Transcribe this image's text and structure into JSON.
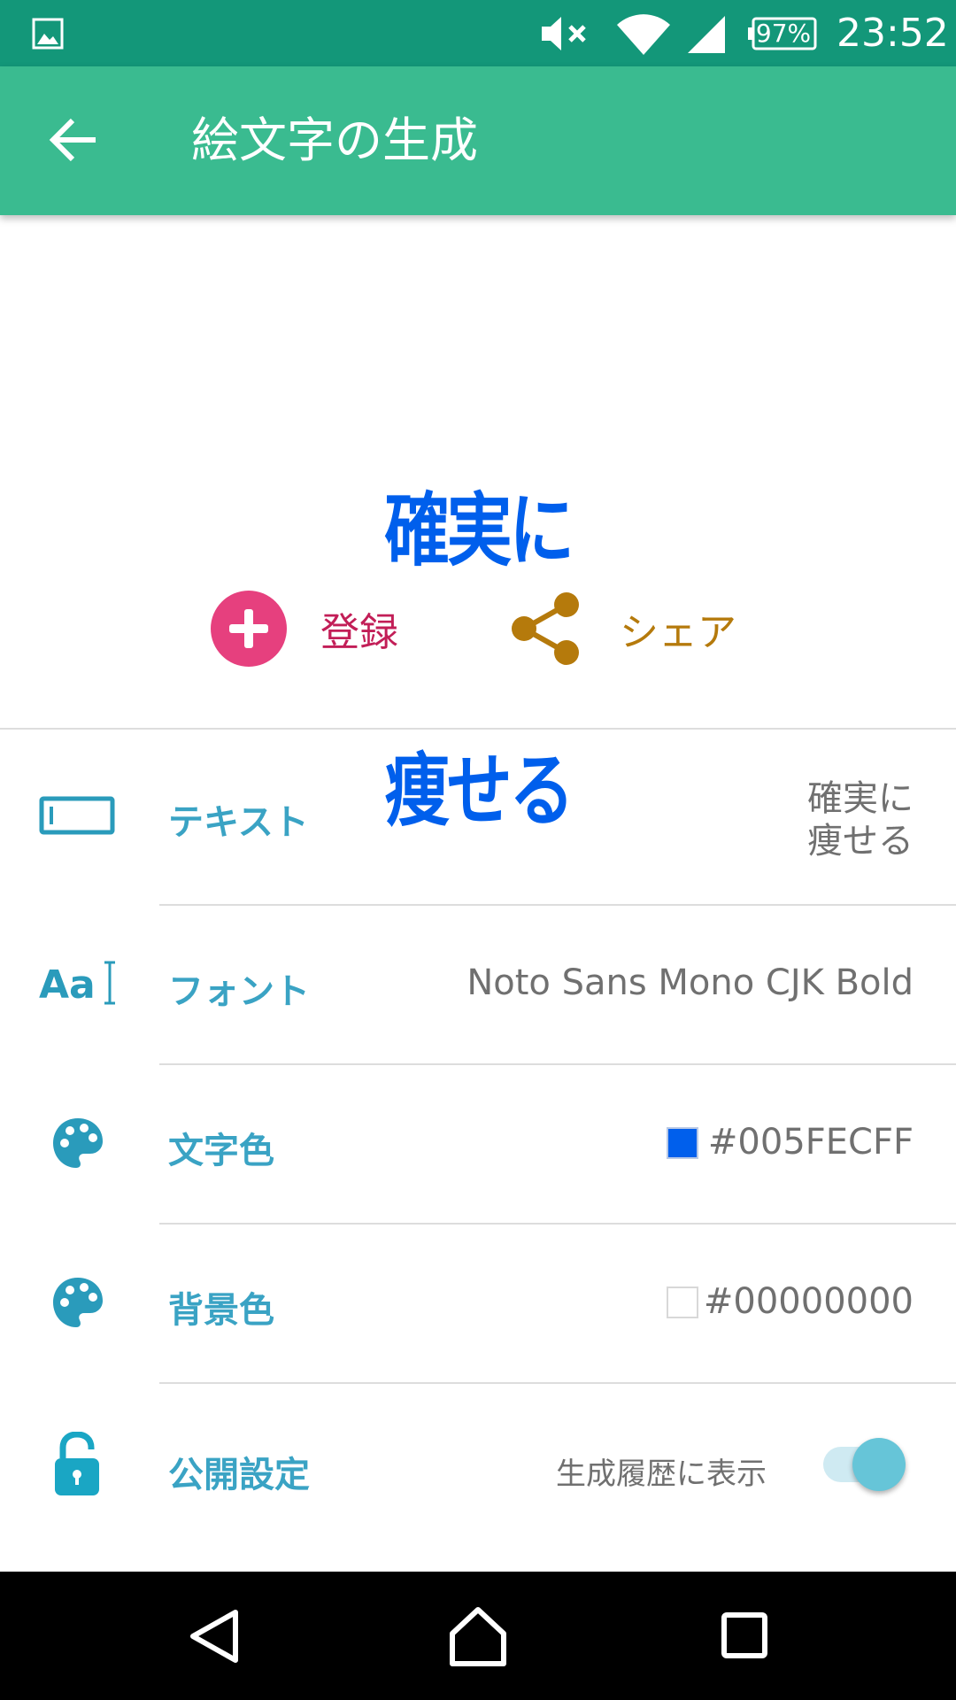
{
  "status_bar": {
    "battery": "97%",
    "time": "23:52",
    "icons": [
      "gallery-icon",
      "mute-icon",
      "wifi-icon",
      "signal-icon",
      "battery-icon"
    ]
  },
  "app_bar": {
    "title": "絵文字の生成",
    "back_icon": "arrow-left-icon"
  },
  "preview": {
    "line1": "確実に",
    "line2": "痩せる",
    "color": "#005FEC"
  },
  "actions": {
    "register_label": "登録",
    "share_label": "シェア",
    "register_color": "#e6407e",
    "share_color": "#b57a0c"
  },
  "settings": {
    "text": {
      "label": "テキスト",
      "value_line1": "確実に",
      "value_line2": "痩せる",
      "icon": "text-field-icon"
    },
    "font": {
      "label": "フォント",
      "value": "Noto Sans Mono CJK Bold",
      "icon": "font-icon"
    },
    "text_color": {
      "label": "文字色",
      "value": "#005FECFF",
      "swatch": "#005FEC",
      "icon": "palette-icon"
    },
    "bg_color": {
      "label": "背景色",
      "value": "#00000000",
      "swatch": "transparent",
      "icon": "palette-icon"
    },
    "visibility": {
      "label": "公開設定",
      "value": "生成履歴に表示",
      "toggle_on": true,
      "icon": "lock-open-icon"
    }
  },
  "nav_bar": {
    "icons": [
      "back-triangle-icon",
      "home-icon",
      "recents-icon"
    ]
  }
}
